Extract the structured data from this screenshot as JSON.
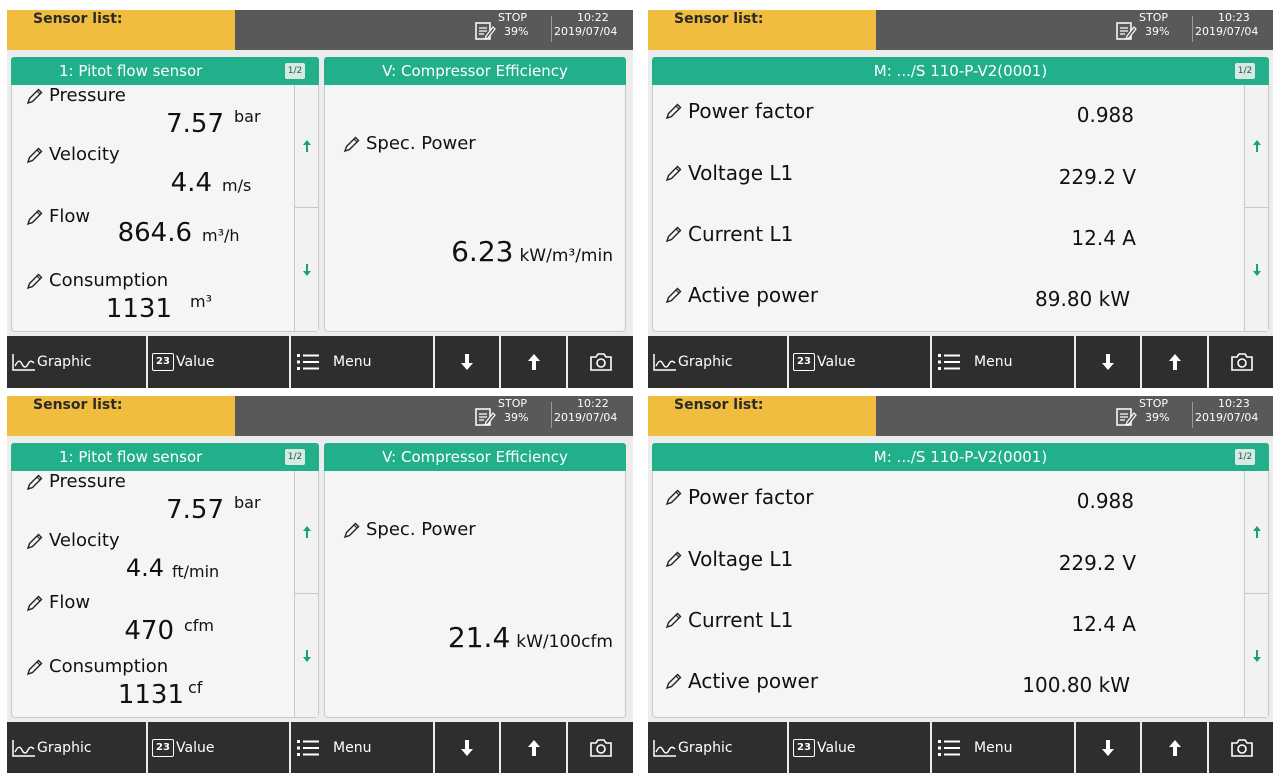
{
  "screens": [
    {
      "title": "Sensor list:",
      "status": {
        "stop": "STOP",
        "percent": "39%",
        "time": "10:22",
        "date": "2019/07/04"
      },
      "left_panel": {
        "header": "1: Pitot flow sensor",
        "page": "1/2",
        "items": [
          {
            "name": "Pressure",
            "value": "7.57",
            "unit": "bar"
          },
          {
            "name": "Velocity",
            "value": "4.4",
            "unit": "m/s"
          },
          {
            "name": "Flow",
            "value": "864.6",
            "unit": "m³/h"
          },
          {
            "name": "Consumption",
            "value": "1131",
            "unit": "m³"
          }
        ]
      },
      "mid_panel": {
        "header": "V: Compressor Efficiency",
        "name": "Spec. Power",
        "value": "6.23",
        "unit": "kW/m³/min"
      },
      "bottom": {
        "graphic": "Graphic",
        "value": "Value",
        "menu": "Menu"
      }
    },
    {
      "title": "Sensor list:",
      "status": {
        "stop": "STOP",
        "percent": "39%",
        "time": "10:23",
        "date": "2019/07/04"
      },
      "right_panel": {
        "header": "M: .../S 110-P-V2(0001)",
        "page": "1/2",
        "items": [
          {
            "name": "Power factor",
            "value": "0.988"
          },
          {
            "name": "Voltage L1",
            "value": "229.2 V"
          },
          {
            "name": "Current L1",
            "value": "12.4 A"
          },
          {
            "name": "Active power",
            "value": "89.80 kW"
          }
        ]
      },
      "bottom": {
        "graphic": "Graphic",
        "value": "Value",
        "menu": "Menu"
      }
    },
    {
      "title": "Sensor list:",
      "status": {
        "stop": "STOP",
        "percent": "39%",
        "time": "10:22",
        "date": "2019/07/04"
      },
      "left_panel": {
        "header": "1: Pitot flow sensor",
        "page": "1/2",
        "items": [
          {
            "name": "Pressure",
            "value": "7.57",
            "unit": "bar"
          },
          {
            "name": "Velocity",
            "value": "4.4",
            "unit": "ft/min"
          },
          {
            "name": "Flow",
            "value": "470",
            "unit": "cfm"
          },
          {
            "name": "Consumption",
            "value": "1131",
            "unit": "cf"
          }
        ]
      },
      "mid_panel": {
        "header": "V: Compressor Efficiency",
        "name": "Spec. Power",
        "value": "21.4",
        "unit": "kW/100cfm"
      },
      "bottom": {
        "graphic": "Graphic",
        "value": "Value",
        "menu": "Menu"
      }
    },
    {
      "title": "Sensor list:",
      "status": {
        "stop": "STOP",
        "percent": "39%",
        "time": "10:23",
        "date": "2019/07/04"
      },
      "right_panel": {
        "header": "M: .../S 110-P-V2(0001)",
        "page": "1/2",
        "items": [
          {
            "name": "Power factor",
            "value": "0.988"
          },
          {
            "name": "Voltage L1",
            "value": "229.2 V"
          },
          {
            "name": "Current L1",
            "value": "12.4 A"
          },
          {
            "name": "Active power",
            "value": "100.80 kW"
          }
        ]
      },
      "bottom": {
        "graphic": "Graphic",
        "value": "Value",
        "menu": "Menu"
      }
    }
  ],
  "icons": [
    "status-note-icon",
    "pencil-icon",
    "arrow-up-icon",
    "arrow-down-icon",
    "graph-icon",
    "value-23-icon",
    "menu-list-icon",
    "camera-icon"
  ],
  "colors": {
    "title_bar": "#f0bd3f",
    "top_bar": "#595959",
    "panel_header": "#22b08c",
    "bottom_bar": "#2e2e2e",
    "background": "#ececec"
  }
}
